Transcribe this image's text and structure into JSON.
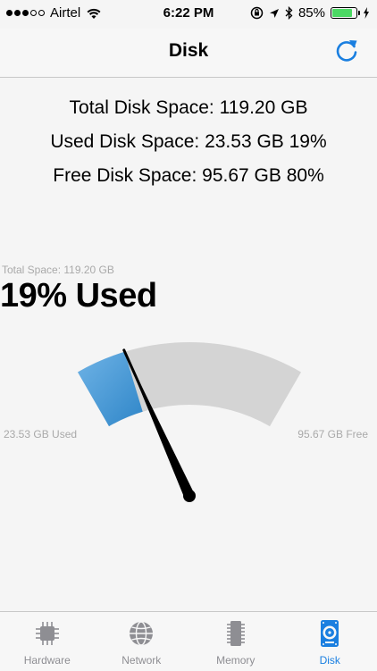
{
  "status_bar": {
    "carrier": "Airtel",
    "time": "6:22 PM",
    "battery": "85%",
    "battery_level": 0.85,
    "signal_bars_filled": 3,
    "signal_bars_total": 5
  },
  "nav": {
    "title": "Disk",
    "refresh_icon": "refresh-icon",
    "accent_color": "#1a7fe0"
  },
  "summary": {
    "total": "Total Disk Space: 119.20 GB",
    "used": "Used Disk Space: 23.53 GB 19%",
    "free": "Free Disk Space: 95.67 GB 80%"
  },
  "gauge": {
    "total_label": "Total Space: 119.20 GB",
    "used_headline": "19% Used",
    "used_label": "23.53 GB Used",
    "free_label": "95.67 GB Free",
    "used_fraction": 0.19,
    "used_color": "#4a9ad4",
    "free_color": "#d4d4d4"
  },
  "tabs": [
    {
      "label": "Hardware",
      "icon": "cpu-chip-icon",
      "active": false
    },
    {
      "label": "Network",
      "icon": "globe-icon",
      "active": false
    },
    {
      "label": "Memory",
      "icon": "memory-stick-icon",
      "active": false
    },
    {
      "label": "Disk",
      "icon": "hard-disk-icon",
      "active": true
    }
  ]
}
